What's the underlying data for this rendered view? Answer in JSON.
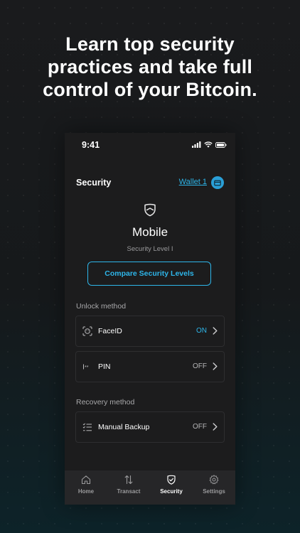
{
  "marketing": {
    "headline_line1": "Learn top security",
    "headline_line2": "practices and take full",
    "headline_line3": "control of your Bitcoin."
  },
  "status_bar": {
    "time": "9:41"
  },
  "header": {
    "title": "Security",
    "wallet_label": "Wallet 1"
  },
  "profile": {
    "title": "Mobile",
    "level": "Security Level I",
    "compare_button": "Compare Security Levels"
  },
  "unlock": {
    "section_label": "Unlock method",
    "items": [
      {
        "label": "FaceID",
        "status": "ON"
      },
      {
        "label": "PIN",
        "status": "OFF"
      }
    ]
  },
  "recovery": {
    "section_label": "Recovery method",
    "items": [
      {
        "label": "Manual Backup",
        "status": "OFF"
      }
    ]
  },
  "tabs": [
    {
      "label": "Home",
      "icon": "home-icon"
    },
    {
      "label": "Transact",
      "icon": "transfer-arrows-icon"
    },
    {
      "label": "Security",
      "icon": "shield-check-icon"
    },
    {
      "label": "Settings",
      "icon": "gear-icon"
    }
  ],
  "active_tab": "Security",
  "colors": {
    "accent": "#2eb6ea",
    "background": "#1c1c1d",
    "tabbar": "#262628"
  }
}
